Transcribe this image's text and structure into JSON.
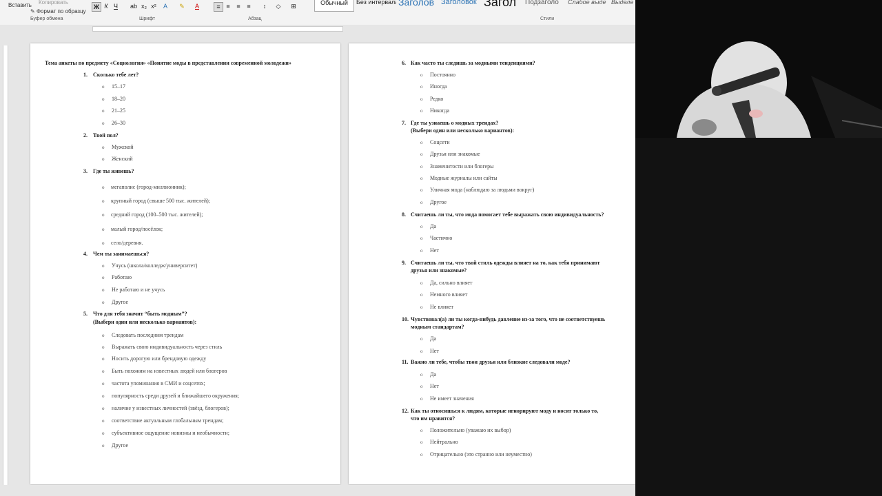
{
  "ribbon": {
    "paste_label": "Вставить",
    "copy_label": "Копировать",
    "format_painter_label": "Формат по образцу",
    "clipboard_group": "Буфер обмена",
    "font_group": "Шрифт",
    "paragraph_group": "Абзац",
    "styles_group": "Стили",
    "bold": "Ж",
    "italic": "К",
    "underline": "Ч",
    "styles": [
      {
        "label": "Обычный",
        "color": "#222222"
      },
      {
        "label": "Без интервала",
        "color": "#222222"
      },
      {
        "label": "Заголов",
        "color": "#2e74b5"
      },
      {
        "label": "Заголовок",
        "color": "#2e74b5"
      },
      {
        "label": "Загол",
        "color": "#111111"
      },
      {
        "label": "Подзаголо",
        "color": "#555555"
      },
      {
        "label": "Слабое выде",
        "color": "#555555"
      },
      {
        "label": "Выделе",
        "color": "#555555"
      }
    ]
  },
  "doc": {
    "title": "Тема анкеты по предмету «Социология» «Понятие моды в представлении современной молодежи»",
    "q1": {
      "num": "1.",
      "text": "Сколько тебе лет?",
      "options": [
        "15–17",
        "18–20",
        "21–25",
        "26–30"
      ]
    },
    "q2": {
      "num": "2.",
      "text": "Твой пол?",
      "options": [
        "Мужской",
        "Женский"
      ]
    },
    "q3": {
      "num": "3.",
      "text": "Где ты живешь?",
      "options": [
        "мегаполис (город-миллионник);",
        "крупный город (свыше 500 тыс. жителей);",
        "средний город (100–500 тыс. жителей);",
        "малый город/посёлок;",
        "село/деревня."
      ]
    },
    "q4": {
      "num": "4.",
      "text": "Чем ты занимаешься?",
      "options": [
        "Учусь (школа/колледж/университет)",
        "Работаю",
        "Не работаю и не учусь",
        "Другое"
      ]
    },
    "q5": {
      "num": "5.",
      "text": "Что для тебя значит “быть модным”?",
      "text2": "(Выбери один или несколько вариантов):",
      "options": [
        "Следовать последним трендам",
        "Выражать свою индивидуальность через стиль",
        "Носить дорогую или брендовую одежду",
        "Быть похожим на известных людей или блогеров",
        "частота упоминания в СМИ и соцсетях;",
        "популярность среди друзей и ближайшего окружения;",
        "наличие у известных личностей (звёзд, блогеров);",
        "соответствие актуальным глобальным трендам;",
        "субъективное ощущение новизны и необычности;",
        "Другое"
      ]
    },
    "q6": {
      "num": "6.",
      "text": "Как часто ты следишь за модными тенденциями?",
      "options": [
        "Постоянно",
        "Иногда",
        "Редко",
        "Никогда"
      ]
    },
    "q7": {
      "num": "7.",
      "text": "Где ты узнаешь о модных трендах?",
      "text2": "(Выбери один или несколько вариантов):",
      "options": [
        "Соцсети",
        "Друзья или знакомые",
        "Знаменитости или блогеры",
        "Модные журналы или сайты",
        "Уличная мода (наблюдаю за людьми вокруг)",
        "Другое"
      ]
    },
    "q8": {
      "num": "8.",
      "text": "Считаешь ли ты, что мода помогает тебе выражать свою индивидуальность?",
      "options": [
        "Да",
        "Частично",
        "Нет"
      ]
    },
    "q9": {
      "num": "9.",
      "text": "Считаешь ли ты, что твой стиль одежды влияет на то, как тебя принимают",
      "text2": "друзья или знакомые?",
      "options": [
        "Да, сильно влияет",
        "Немного влияет",
        "Не влияет"
      ]
    },
    "q10": {
      "num": "10.",
      "text": "Чувствовал(а) ли ты когда-нибудь давление из-за того, что не соответствуешь",
      "text2": "модным стандартам?",
      "options": [
        "Да",
        "Нет"
      ]
    },
    "q11": {
      "num": "11.",
      "text": "Важно ли тебе, чтобы твои друзья или близкие следовали моде?",
      "options": [
        "Да",
        "Нет",
        "Не имеет значения"
      ]
    },
    "q12": {
      "num": "12.",
      "text": "Как ты относишься к людям, которые игнорируют моду и носят только то,",
      "text2": "что им нравится?",
      "options": [
        "Положительно (уважаю их выбор)",
        "Нейтрально",
        "Отрицательно (это странно или неуместно)"
      ]
    }
  },
  "webcam": {
    "label": "webcam-overlay"
  }
}
